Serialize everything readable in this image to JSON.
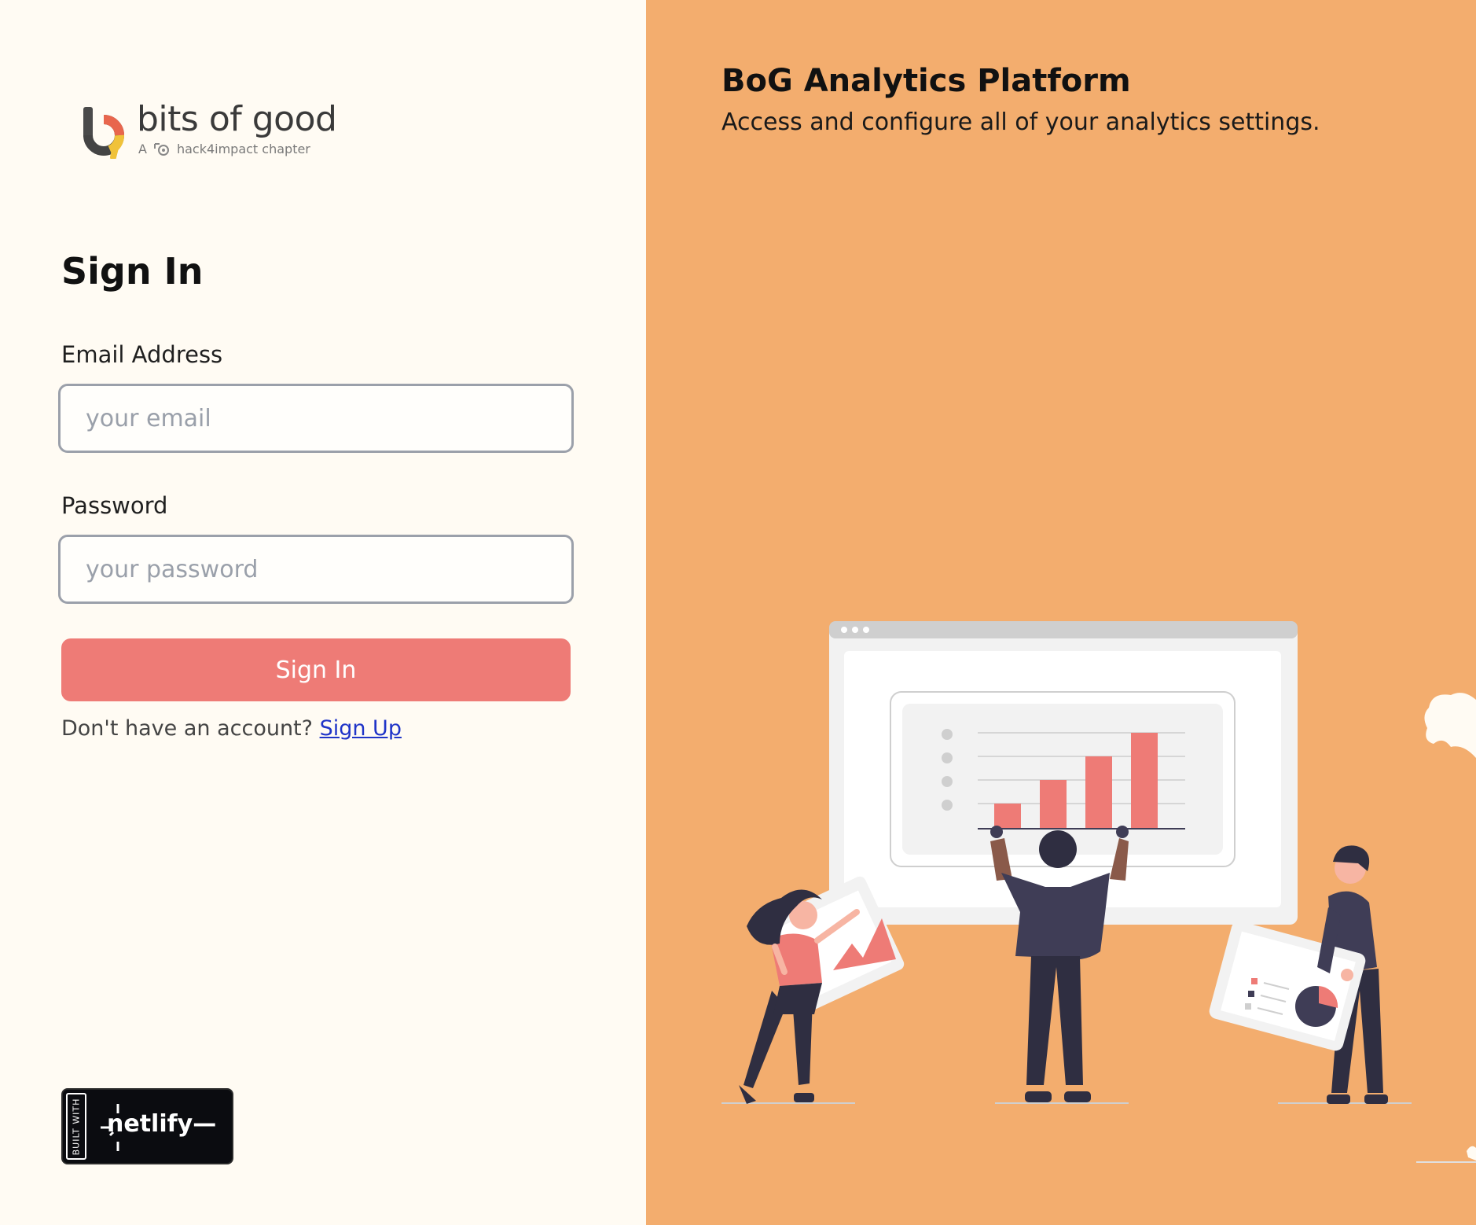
{
  "brand": {
    "name": "bits of good",
    "tagline_prefix": "A",
    "tagline": "hack4impact chapter"
  },
  "form": {
    "title": "Sign In",
    "email_label": "Email Address",
    "email_placeholder": "your email",
    "password_label": "Password",
    "password_placeholder": "your password",
    "submit_label": "Sign In",
    "no_account_text": "Don't have an account?",
    "signup_link": "Sign Up"
  },
  "badge": {
    "built_with": "BUILT WITH",
    "name": "netlify"
  },
  "hero": {
    "title": "BoG Analytics Platform",
    "subtitle": "Access and configure all of your analytics settings."
  },
  "colors": {
    "left_bg": "#fffbf3",
    "right_bg": "#f3ad6e",
    "accent": "#ee7b76",
    "link": "#1f34c8"
  }
}
